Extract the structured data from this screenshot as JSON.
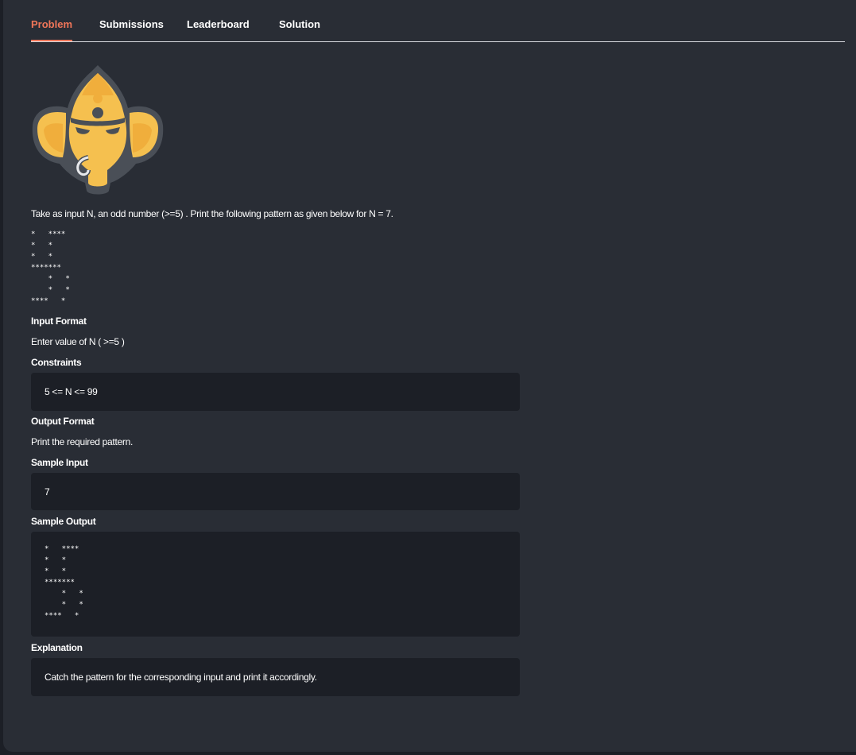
{
  "tabs": [
    {
      "label": "Problem",
      "active": true
    },
    {
      "label": "Submissions",
      "active": false
    },
    {
      "label": "Leaderboard",
      "active": false
    },
    {
      "label": "Solution",
      "active": false
    }
  ],
  "logo": {
    "icon": "ganesha-logo-icon"
  },
  "problem": {
    "statement": "Take as input N, an odd number (>=5) . Print the following pattern as given below for N = 7.",
    "pattern": "*   ****\n*   *\n*   *\n*******\n    *   *\n    *   *\n****   *",
    "input_format_heading": "Input Format",
    "input_format": "Enter value of N ( >=5 )",
    "constraints_heading": "Constraints",
    "constraints": "5 <= N <= 99",
    "output_format_heading": "Output Format",
    "output_format": "Print the required pattern.",
    "sample_input_heading": "Sample Input",
    "sample_input": "7",
    "sample_output_heading": "Sample Output",
    "sample_output": "*   ****\n*   *\n*   *\n*******\n    *   *\n    *   *\n****   *",
    "explanation_heading": "Explanation",
    "explanation": "Catch the pattern for the corresponding input and print it accordingly."
  },
  "colors": {
    "accent": "#f07659",
    "background": "#292d35",
    "code_background": "#1c1f26"
  }
}
